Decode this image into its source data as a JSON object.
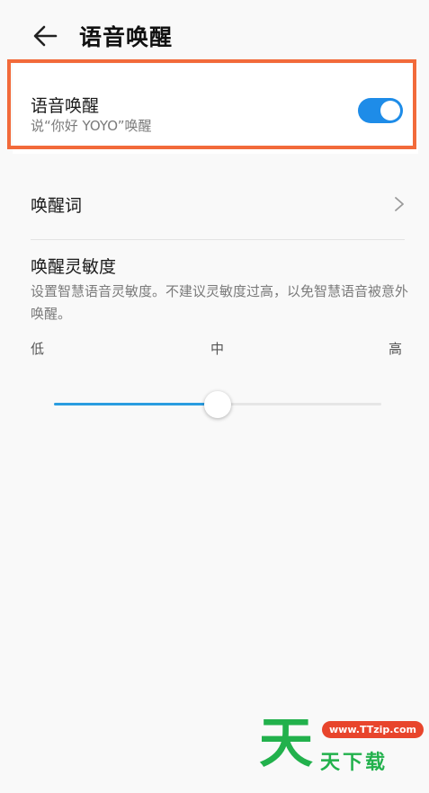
{
  "header": {
    "title": "语音唤醒",
    "back_icon": "arrow-left-icon"
  },
  "voice_wakeup": {
    "title": "语音唤醒",
    "subtitle": "说“你好 YOYO”唤醒",
    "toggle_on": true,
    "toggle_color": "#1e8ce8",
    "highlight_color": "#f26a3a"
  },
  "wake_word": {
    "label": "唤醒词",
    "chevron_icon": "chevron-right-icon"
  },
  "sensitivity": {
    "title": "唤醒灵敏度",
    "description": "设置智慧语音灵敏度。不建议灵敏度过高，以免智慧语音被意外唤醒。",
    "levels": [
      "低",
      "中",
      "高"
    ],
    "value": 0.5,
    "accent_color": "#2a9de0"
  },
  "watermark": {
    "glyph": "天",
    "url": "www.TTzip.com",
    "text": "天下载"
  }
}
